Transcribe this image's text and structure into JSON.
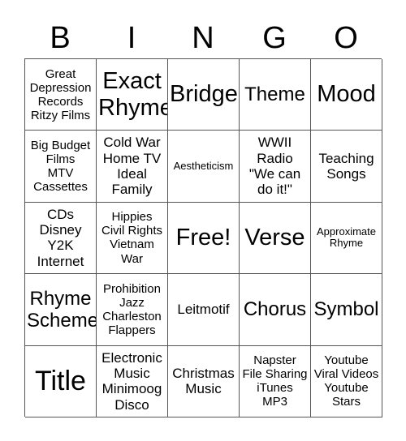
{
  "card": {
    "header_letters": [
      "B",
      "I",
      "N",
      "G",
      "O"
    ],
    "rows": [
      [
        {
          "text": "Great\nDepression\nRecords\nRitzy Films",
          "size": "fs-s"
        },
        {
          "text": "Exact\nRhyme",
          "size": "fs-xl"
        },
        {
          "text": "Bridge",
          "size": "fs-xl"
        },
        {
          "text": "Theme",
          "size": "fs-l"
        },
        {
          "text": "Mood",
          "size": "fs-xl"
        }
      ],
      [
        {
          "text": "Big Budget\nFilms\nMTV\nCassettes",
          "size": "fs-s"
        },
        {
          "text": "Cold War\nHome TV\nIdeal\nFamily",
          "size": "fs-m"
        },
        {
          "text": "Aestheticism",
          "size": "fs-xs"
        },
        {
          "text": "WWII\nRadio\n\"We can\ndo it!\"",
          "size": "fs-m"
        },
        {
          "text": "Teaching\nSongs",
          "size": "fs-m"
        }
      ],
      [
        {
          "text": "CDs\nDisney\nY2K\nInternet",
          "size": "fs-m"
        },
        {
          "text": "Hippies\nCivil Rights\nVietnam\nWar",
          "size": "fs-s"
        },
        {
          "text": "Free!",
          "size": "fs-xl"
        },
        {
          "text": "Verse",
          "size": "fs-xl"
        },
        {
          "text": "Approximate\nRhyme",
          "size": "fs-xs"
        }
      ],
      [
        {
          "text": "Rhyme\nScheme",
          "size": "fs-l"
        },
        {
          "text": "Prohibition\nJazz\nCharleston\nFlappers",
          "size": "fs-s"
        },
        {
          "text": "Leitmotif",
          "size": "fs-m"
        },
        {
          "text": "Chorus",
          "size": "fs-l"
        },
        {
          "text": "Symbol",
          "size": "fs-l"
        }
      ],
      [
        {
          "text": "Title",
          "size": "fs-xxl"
        },
        {
          "text": "Electronic\nMusic\nMinimoog\nDisco",
          "size": "fs-m"
        },
        {
          "text": "Christmas\nMusic",
          "size": "fs-m"
        },
        {
          "text": "Napster\nFile Sharing\niTunes\nMP3",
          "size": "fs-s"
        },
        {
          "text": "Youtube\nViral Videos\nYoutube\nStars",
          "size": "fs-s"
        }
      ]
    ]
  },
  "colors": {
    "background": "#ffffff",
    "text": "#000000",
    "grid_line": "#555555"
  }
}
